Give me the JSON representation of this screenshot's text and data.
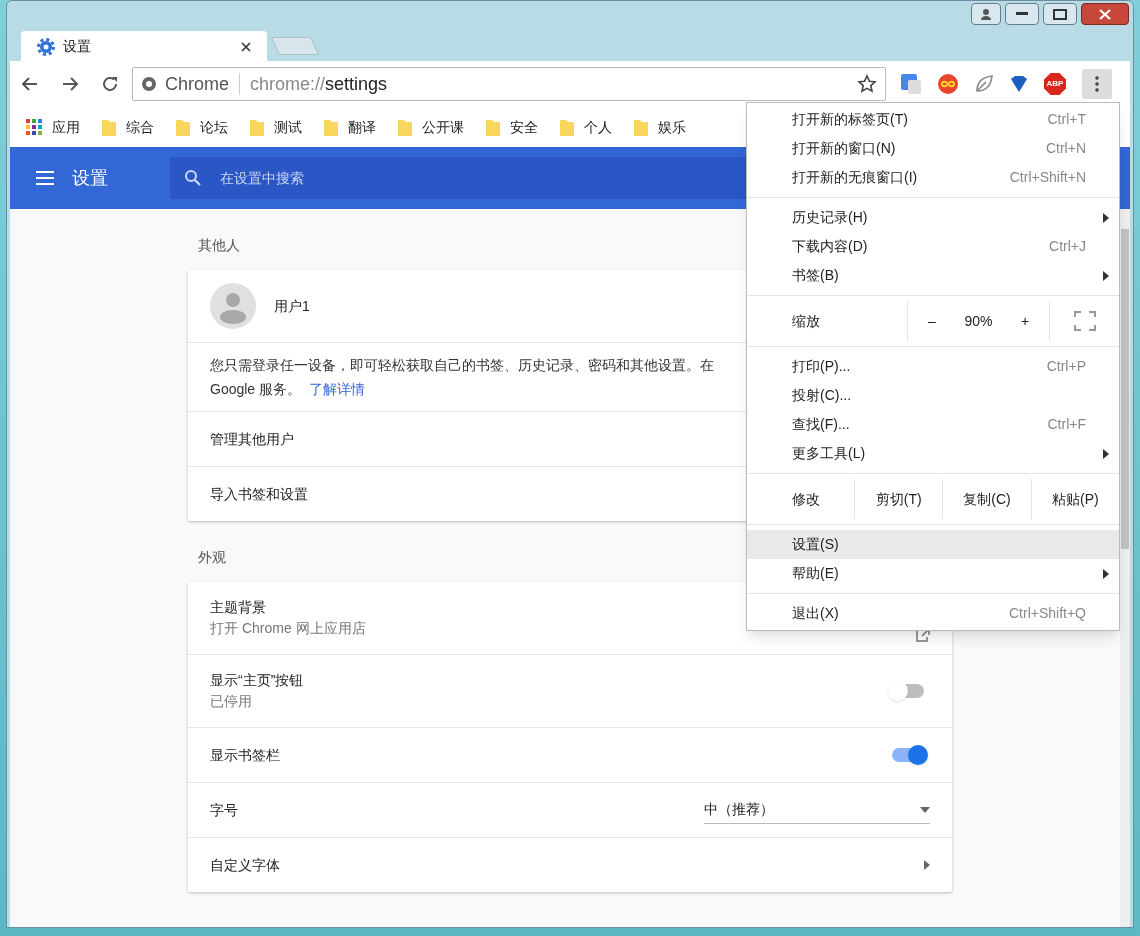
{
  "tab": {
    "title": "设置"
  },
  "address": {
    "site": "Chrome",
    "scheme": "chrome://",
    "path": "settings"
  },
  "extensions": [
    {
      "kind": "translate"
    },
    {
      "kind": "infinity"
    },
    {
      "kind": "leaf"
    },
    {
      "kind": "gem"
    },
    {
      "kind": "abp",
      "label": "ABP"
    }
  ],
  "bookmarks": [
    {
      "kind": "apps",
      "label": "应用"
    },
    {
      "kind": "folder",
      "label": "综合"
    },
    {
      "kind": "folder",
      "label": "论坛"
    },
    {
      "kind": "folder",
      "label": "测试"
    },
    {
      "kind": "folder",
      "label": "翻译"
    },
    {
      "kind": "folder",
      "label": "公开课"
    },
    {
      "kind": "folder",
      "label": "安全"
    },
    {
      "kind": "folder",
      "label": "个人"
    },
    {
      "kind": "folder",
      "label": "娱乐"
    }
  ],
  "header": {
    "title": "设置",
    "search_placeholder": "在设置中搜索"
  },
  "sections": [
    {
      "heading": "其他人",
      "rows": [
        {
          "kind": "profile",
          "label": "用户1"
        },
        {
          "kind": "note",
          "text": "您只需登录任一设备，即可轻松获取自己的书签、历史记录、密码和其他设置。在",
          "text2": "Google 服务。",
          "link": "了解详情"
        },
        {
          "kind": "plain",
          "label": "管理其他用户"
        },
        {
          "kind": "plain",
          "label": "导入书签和设置"
        }
      ]
    },
    {
      "heading": "外观",
      "rows": [
        {
          "kind": "external",
          "label": "主题背景",
          "sublabel": "打开 Chrome 网上应用店"
        },
        {
          "kind": "toggle",
          "label": "显示“主页”按钮",
          "sublabel": "已停用",
          "on": false
        },
        {
          "kind": "toggle",
          "label": "显示书签栏",
          "on": true
        },
        {
          "kind": "select",
          "label": "字号",
          "value": "中（推荐）"
        },
        {
          "kind": "arrow",
          "label": "自定义字体"
        }
      ]
    }
  ],
  "menu": [
    {
      "kind": "item",
      "label": "打开新的标签页(T)",
      "shortcut": "Ctrl+T",
      "submenu": false,
      "selected": false
    },
    {
      "kind": "item",
      "label": "打开新的窗口(N)",
      "shortcut": "Ctrl+N",
      "submenu": false,
      "selected": false
    },
    {
      "kind": "item",
      "label": "打开新的无痕窗口(I)",
      "shortcut": "Ctrl+Shift+N",
      "submenu": false,
      "selected": false
    },
    {
      "kind": "separator"
    },
    {
      "kind": "item",
      "label": "历史记录(H)",
      "submenu": true,
      "selected": false
    },
    {
      "kind": "item",
      "label": "下载内容(D)",
      "shortcut": "Ctrl+J",
      "submenu": false,
      "selected": false
    },
    {
      "kind": "item",
      "label": "书签(B)",
      "submenu": true,
      "selected": false
    },
    {
      "kind": "separator"
    },
    {
      "kind": "zoom",
      "label": "缩放",
      "minus": "–",
      "value": "90%",
      "plus": "+"
    },
    {
      "kind": "separator"
    },
    {
      "kind": "item",
      "label": "打印(P)...",
      "shortcut": "Ctrl+P",
      "submenu": false,
      "selected": false
    },
    {
      "kind": "item",
      "label": "投射(C)...",
      "submenu": false,
      "selected": false
    },
    {
      "kind": "item",
      "label": "查找(F)...",
      "shortcut": "Ctrl+F",
      "submenu": false,
      "selected": false
    },
    {
      "kind": "item",
      "label": "更多工具(L)",
      "submenu": true,
      "selected": false
    },
    {
      "kind": "separator"
    },
    {
      "kind": "edit",
      "label": "修改",
      "buttons": [
        "剪切(T)",
        "复制(C)",
        "粘贴(P)"
      ]
    },
    {
      "kind": "separator"
    },
    {
      "kind": "item",
      "label": "设置(S)",
      "submenu": false,
      "selected": true
    },
    {
      "kind": "item",
      "label": "帮助(E)",
      "submenu": true,
      "selected": false
    },
    {
      "kind": "separator"
    },
    {
      "kind": "item",
      "label": "退出(X)",
      "shortcut": "Ctrl+Shift+Q",
      "submenu": false,
      "selected": false
    }
  ]
}
